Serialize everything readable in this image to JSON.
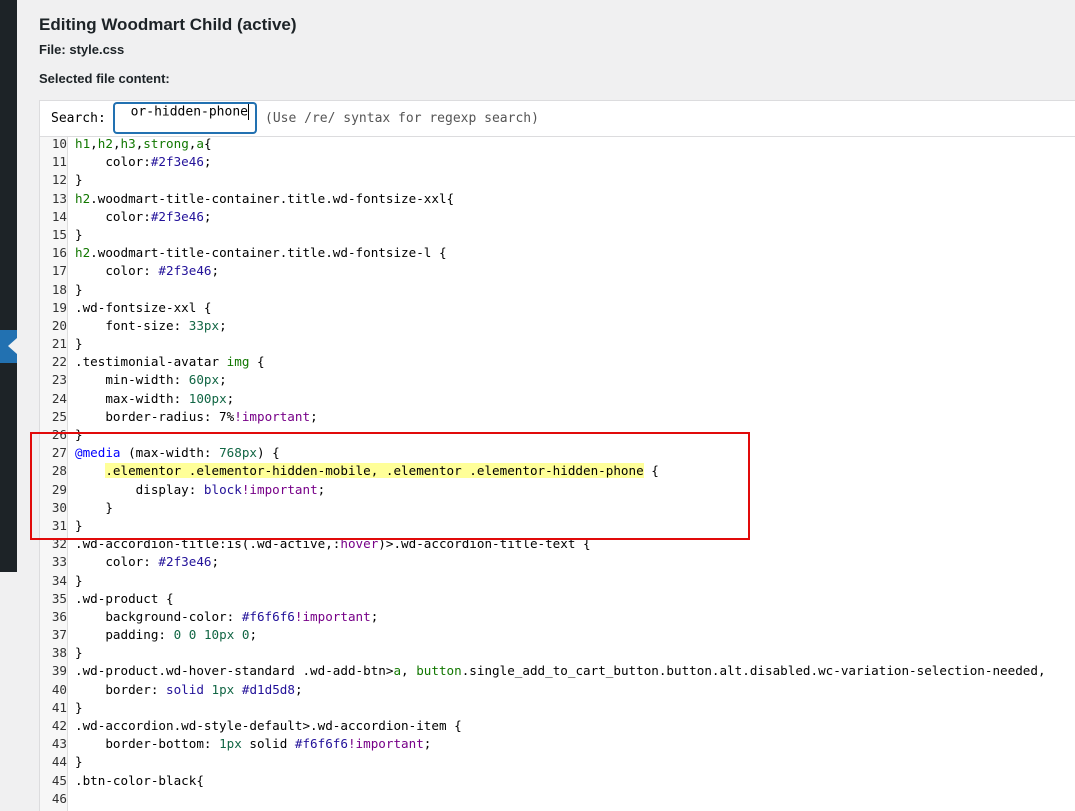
{
  "page": {
    "title": "Editing Woodmart Child (active)",
    "file_line": "File: style.css",
    "selected_label": "Selected file content:"
  },
  "search": {
    "label": "Search:",
    "value": "or-hidden-phone",
    "hint": "(Use /re/ syntax for regexp search)"
  },
  "code_lines": [
    {
      "n": "10",
      "text": "h1,h2,h3,strong,a{"
    },
    {
      "n": "11",
      "text": "    color:#2f3e46;"
    },
    {
      "n": "12",
      "text": "}"
    },
    {
      "n": "13",
      "text": "h2.woodmart-title-container.title.wd-fontsize-xxl{"
    },
    {
      "n": "14",
      "text": "    color:#2f3e46;"
    },
    {
      "n": "15",
      "text": "}"
    },
    {
      "n": "16",
      "text": "h2.woodmart-title-container.title.wd-fontsize-l {"
    },
    {
      "n": "17",
      "text": "    color: #2f3e46;"
    },
    {
      "n": "18",
      "text": "}"
    },
    {
      "n": "19",
      "text": ".wd-fontsize-xxl {"
    },
    {
      "n": "20",
      "text": "    font-size: 33px;"
    },
    {
      "n": "21",
      "text": "}"
    },
    {
      "n": "22",
      "text": ".testimonial-avatar img {"
    },
    {
      "n": "23",
      "text": "    min-width: 60px;"
    },
    {
      "n": "24",
      "text": "    max-width: 100px;"
    },
    {
      "n": "25",
      "text": "    border-radius: 7%!important;"
    },
    {
      "n": "26",
      "text": "}"
    },
    {
      "n": "27",
      "text": "@media (max-width: 768px) {"
    },
    {
      "n": "28",
      "text": "    .elementor .elementor-hidden-mobile, .elementor .elementor-hidden-phone {"
    },
    {
      "n": "29",
      "text": "        display: block!important;"
    },
    {
      "n": "30",
      "text": "    }"
    },
    {
      "n": "31",
      "text": "}"
    },
    {
      "n": "32",
      "text": ".wd-accordion-title:is(.wd-active,:hover)>.wd-accordion-title-text {"
    },
    {
      "n": "33",
      "text": "    color: #2f3e46;"
    },
    {
      "n": "34",
      "text": "}"
    },
    {
      "n": "35",
      "text": ".wd-product {"
    },
    {
      "n": "36",
      "text": "    background-color: #f6f6f6!important;"
    },
    {
      "n": "37",
      "text": "    padding: 0 0 10px 0;"
    },
    {
      "n": "38",
      "text": "}"
    },
    {
      "n": "39",
      "text": ".wd-product.wd-hover-standard .wd-add-btn>a, button.single_add_to_cart_button.button.alt.disabled.wc-variation-selection-needed,"
    },
    {
      "n": "40",
      "text": "    border: solid 1px #d1d5d8;"
    },
    {
      "n": "41",
      "text": "}"
    },
    {
      "n": "42",
      "text": ".wd-accordion.wd-style-default>.wd-accordion-item {"
    },
    {
      "n": "43",
      "text": "    border-bottom: 1px solid #f6f6f6!important;"
    },
    {
      "n": "44",
      "text": "}"
    },
    {
      "n": "45",
      "text": ".btn-color-black{"
    },
    {
      "n": "46",
      "text": ""
    }
  ],
  "highlight_line": "28",
  "colors": {
    "highlight_box": "#e10a0a",
    "search_match": "#ffff99",
    "admin_menu_active": "#2271b1"
  }
}
